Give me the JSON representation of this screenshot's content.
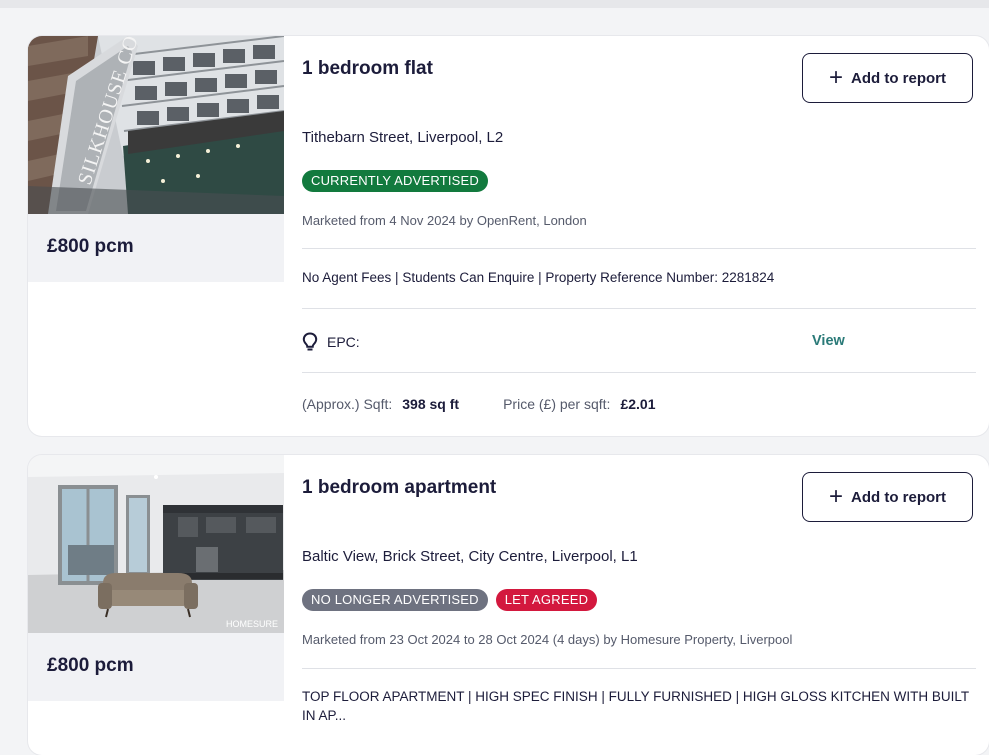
{
  "colors": {
    "advertised_green": "#127a3e",
    "no_longer_grey": "#6e7280",
    "let_agreed_red": "#d3183e",
    "view_link_teal": "#2a7a78",
    "text_dark": "#1c1c3a"
  },
  "icons": {
    "plus": "plus-icon",
    "epc": "lightbulb-icon"
  },
  "listings": [
    {
      "price": "£800 pcm",
      "title": "1 bedroom flat",
      "add_button_label": "Add to report",
      "address": "Tithebarn Street, Liverpool, L2",
      "badges": [
        "CURRENTLY ADVERTISED"
      ],
      "marketed": "Marketed from 4 Nov 2024 by OpenRent, London",
      "features": "No Agent Fees | Students Can Enquire | Property Reference Number: 2281824",
      "epc_label": "EPC:",
      "view_label": "View",
      "sqft_label": "(Approx.) Sqft:",
      "sqft_value": "398 sq ft",
      "price_per_sqft_label": "Price (£) per sqft:",
      "price_per_sqft_value": "£2.01",
      "photo_sign_text": "SILKHOUSE COURT"
    },
    {
      "price": "£800 pcm",
      "title": "1 bedroom apartment",
      "add_button_label": "Add to report",
      "address": "Baltic View, Brick Street, City Centre, Liverpool, L1",
      "badges": [
        "NO LONGER ADVERTISED",
        "LET AGREED"
      ],
      "marketed": "Marketed from 23 Oct 2024 to 28 Oct 2024 (4 days) by Homesure Property, Liverpool",
      "features": "TOP FLOOR APARTMENT | HIGH SPEC FINISH | FULLY FURNISHED | HIGH GLOSS KITCHEN WITH BUILT IN AP...",
      "photo_watermark": "HOMESURE"
    }
  ]
}
